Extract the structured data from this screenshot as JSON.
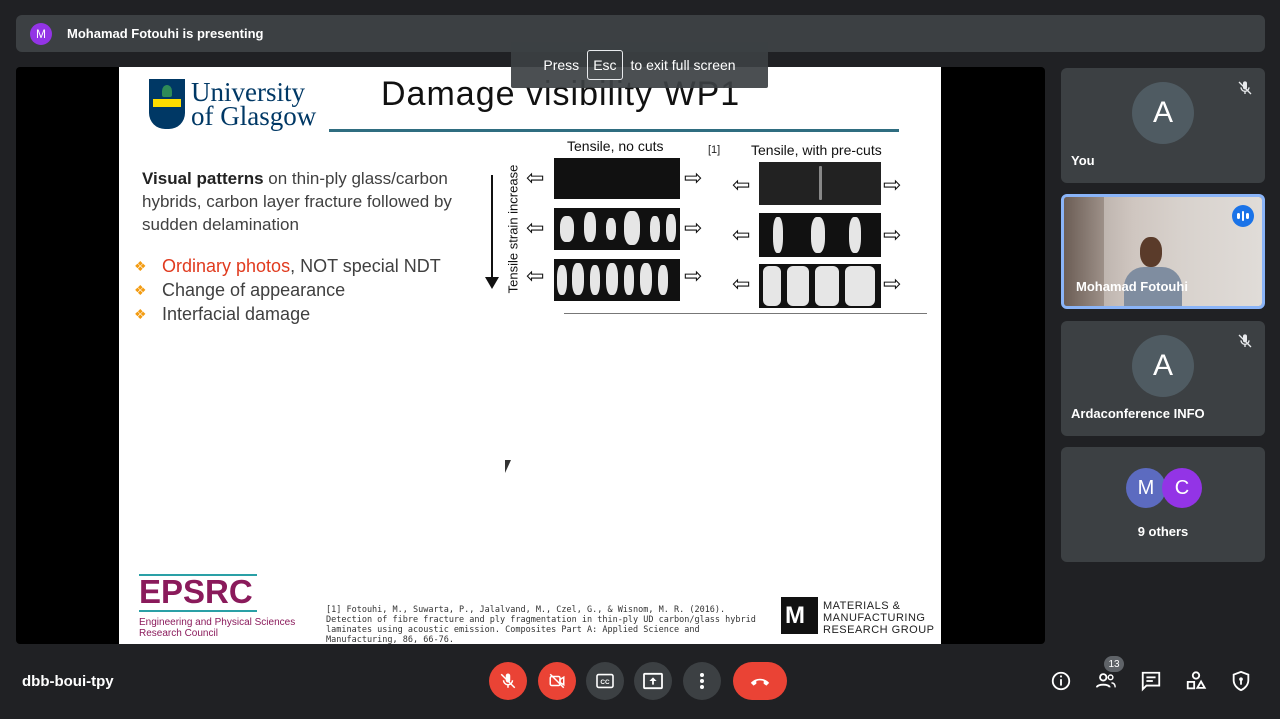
{
  "presenting": {
    "avatar_letter": "M",
    "text": "Mohamad Fotouhi is presenting"
  },
  "fullscreen_toast": {
    "press": "Press",
    "key": "Esc",
    "suffix": "to exit full screen"
  },
  "slide": {
    "university_line1": "University",
    "university_line2": "of Glasgow",
    "title": "Damage visibility WP1",
    "intro_bold": "Visual patterns",
    "intro_rest": " on thin-ply glass/carbon hybrids, carbon layer fracture followed by sudden delamination",
    "bullets": [
      {
        "highlight": "Ordinary photos",
        "rest": ", NOT special NDT"
      },
      {
        "highlight": "",
        "rest": "Change of appearance"
      },
      {
        "highlight": "",
        "rest": "Interfacial damage"
      }
    ],
    "tensile_no_cuts": "Tensile, no cuts",
    "tensile_precuts": "Tensile, with pre-cuts",
    "ref_tag": "[1]",
    "strain_label": "Tensile  strain increase",
    "epsrc": "EPSRC",
    "epsrc_sub": "Engineering and Physical Sciences Research Council",
    "citation": "[1] Fotouhi, M., Suwarta, P., Jalalvand, M., Czel, G., & Wisnom, M. R. (2016). Detection of fibre fracture and ply fragmentation in thin-ply UD carbon/glass hybrid laminates using acoustic emission. Composites Part A: Applied Science and Manufacturing, 86, 66-76.",
    "mmrg_line1": "MATERIALS &",
    "mmrg_line2": "MANUFACTURING",
    "mmrg_line3": "RESEARCH GROUP"
  },
  "tiles": [
    {
      "avatar": "A",
      "name": "You",
      "muted": true
    },
    {
      "name": "Mohamad Fotouhi",
      "speaking": true
    },
    {
      "avatar": "A",
      "name": "Ardaconference INFO",
      "muted": true
    },
    {
      "avatars": [
        "M",
        "C"
      ],
      "name": "9 others"
    }
  ],
  "meeting_code": "dbb-boui-tpy",
  "participants_count": "13",
  "colors": {
    "accent_blue": "#8ab4f8",
    "danger_red": "#ea4335",
    "bg": "#202124",
    "tile": "#3c4043"
  }
}
